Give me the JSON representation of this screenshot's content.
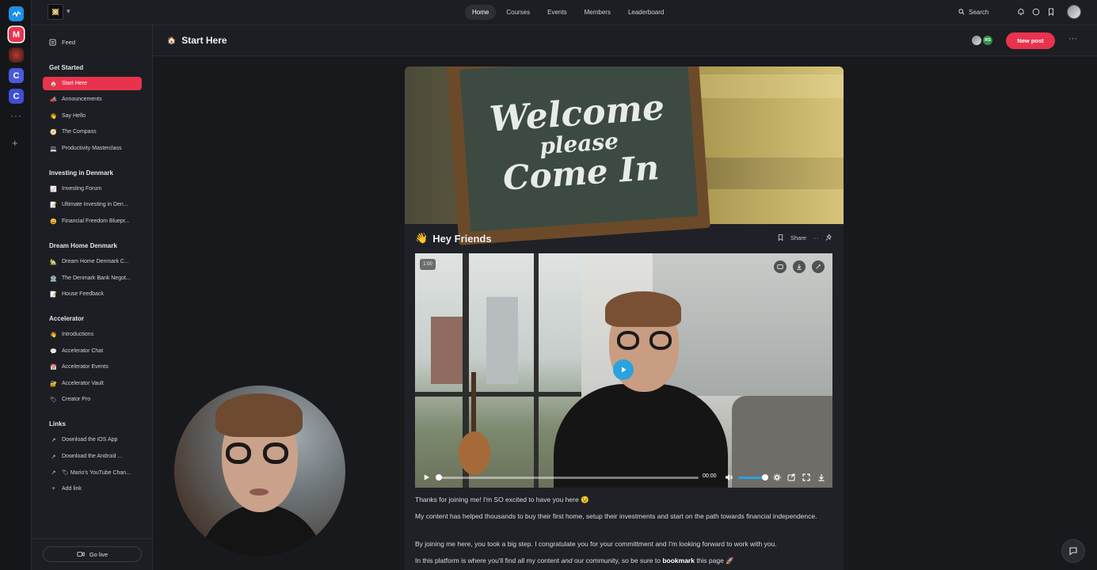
{
  "rail": {
    "items": [
      {
        "label": "",
        "color": "#1f8fe8",
        "icon": "community-logo-icon"
      },
      {
        "label": "M",
        "color": "#e8334f"
      },
      {
        "label": "",
        "color": "#6b2a2a",
        "icon": "space-logo-icon"
      },
      {
        "label": "C",
        "color": "#4a59d9"
      },
      {
        "label": "C",
        "color": "#3f4fd4"
      }
    ],
    "more": "···",
    "add": "+"
  },
  "topbar": {
    "nav": [
      "Home",
      "Courses",
      "Events",
      "Members",
      "Leaderboard"
    ],
    "active_nav": "Home",
    "search_label": "Search"
  },
  "sidebar": {
    "feed_label": "Feed",
    "sections": [
      {
        "title": "Get Started",
        "items": [
          {
            "emoji": "🏠",
            "label": "Start Here",
            "active": true
          },
          {
            "emoji": "📣",
            "label": "Announcements"
          },
          {
            "emoji": "👋",
            "label": "Say Hello"
          },
          {
            "emoji": "🧭",
            "label": "The Compass"
          },
          {
            "emoji": "💻",
            "label": "Productivity Masterclass"
          }
        ]
      },
      {
        "title": "Investing in Denmark",
        "items": [
          {
            "emoji": "📈",
            "label": "Investing Forum"
          },
          {
            "emoji": "📝",
            "label": "Ultimate Investing in Den..."
          },
          {
            "emoji": "😀",
            "label": "Financial Freedom Bluepr..."
          }
        ]
      },
      {
        "title": "Dream Home Denmark",
        "items": [
          {
            "emoji": "🏡",
            "label": "Dream Home Denmark C..."
          },
          {
            "emoji": "🏦",
            "label": "The Denmark Bank Negot..."
          },
          {
            "emoji": "📝",
            "label": "House Feedback"
          }
        ]
      },
      {
        "title": "Accelerator",
        "items": [
          {
            "emoji": "👋",
            "label": "Introductions"
          },
          {
            "emoji": "💬",
            "label": "Accelerator Chat"
          },
          {
            "emoji": "📅",
            "label": "Accelerator Events"
          },
          {
            "emoji": "🔐",
            "label": "Accelerator Vault"
          },
          {
            "emoji": "🏷",
            "label": "Creator Pro"
          }
        ]
      },
      {
        "title": "Links",
        "items": [
          {
            "emoji": "↗",
            "label": " Download the iOS App"
          },
          {
            "emoji": "↗",
            "label": " Download the Android ..."
          },
          {
            "emoji": "↗",
            "label": "🏷 Mario's YouTube Chan..."
          },
          {
            "emoji": "+",
            "label": "Add link"
          }
        ]
      }
    ],
    "go_live_label": "Go live"
  },
  "header": {
    "icon": "🏠",
    "title": "Start Here",
    "member_initials": "RS",
    "new_post_label": "New post",
    "more": "···"
  },
  "post": {
    "cover_text": [
      "Welcome",
      "please",
      "Come In"
    ],
    "title_emoji": "👋",
    "title": "Hey Friends",
    "share_label": "Share",
    "more": "···",
    "video": {
      "badge_time": "1:00",
      "current_time": "00:00",
      "progress": 0,
      "volume": 1
    },
    "paragraphs": {
      "p1": "Thanks for joining me! I'm SO excited to have you here 😉",
      "p2": "My content has helped thousands to buy their first home, setup their investments and start on the path towards financial independence.",
      "p3": "By joining me here, you took a big step. I congratulate you for your committment and I'm looking forward to work with you.",
      "p4_a": "In this platform is where you'll find all my content ",
      "p4_b": "and",
      "p4_c": " our community, so be sure to ",
      "p4_d": "bookmark",
      "p4_e": " this page 🚀"
    }
  },
  "colors": {
    "accent": "#e8334f",
    "play": "#2aa3df"
  }
}
